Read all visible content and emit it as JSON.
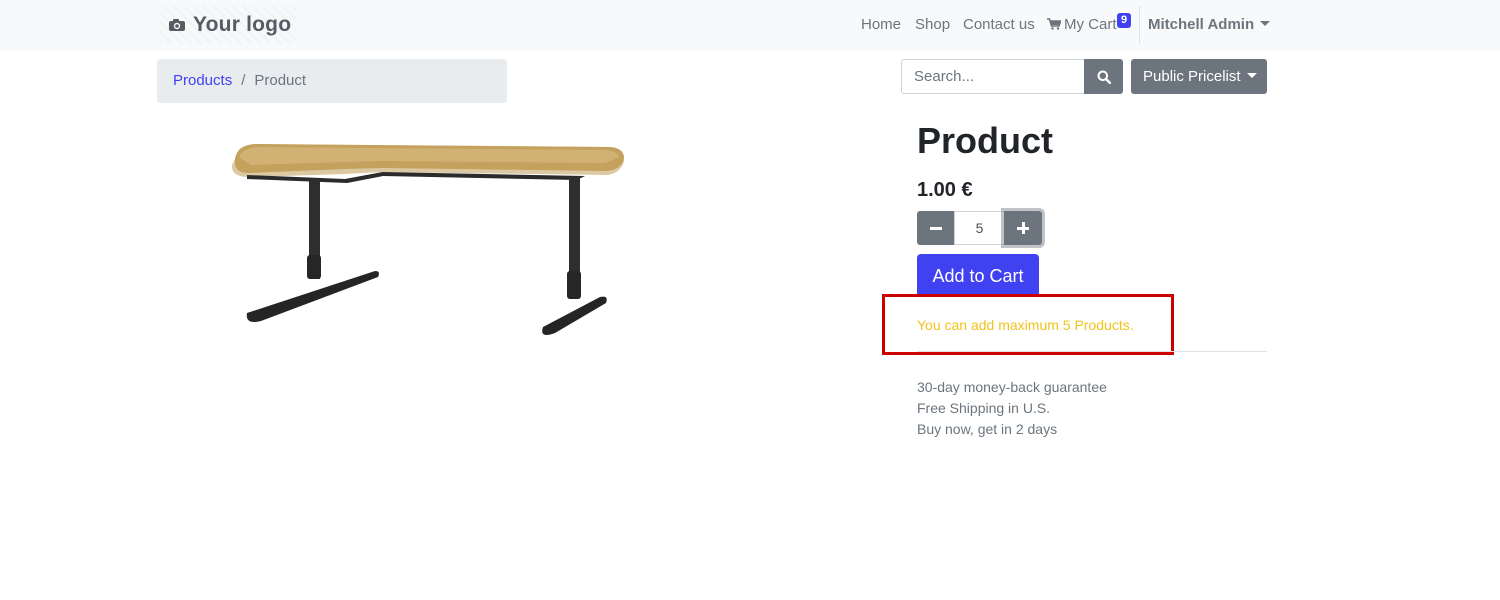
{
  "navbar": {
    "logo_text": "Your logo",
    "logo_icon": "camera-icon",
    "links": [
      "Home",
      "Shop",
      "Contact us"
    ],
    "cart": {
      "label": "My Cart",
      "icon": "shopping-cart-icon",
      "count": "9"
    },
    "user": "Mitchell Admin"
  },
  "breadcrumb": {
    "parent": "Products",
    "separator": "/",
    "current": "Product"
  },
  "search": {
    "placeholder": "Search...",
    "icon": "search-icon"
  },
  "pricelist": {
    "label": "Public Pricelist"
  },
  "product": {
    "title": "Product",
    "price": "1.00 €",
    "quantity": "5",
    "add_to_cart_label": "Add to Cart",
    "image": "l-shaped-desk-image"
  },
  "alert": {
    "message": "You can add maximum 5 Products."
  },
  "features": [
    "30-day money-back guarantee",
    "Free Shipping in U.S.",
    "Buy now, get in 2 days"
  ],
  "colors": {
    "primary": "#4041f1",
    "secondary": "#6c757d",
    "warning_text": "#f0c419",
    "highlight_border": "#cc0000"
  }
}
